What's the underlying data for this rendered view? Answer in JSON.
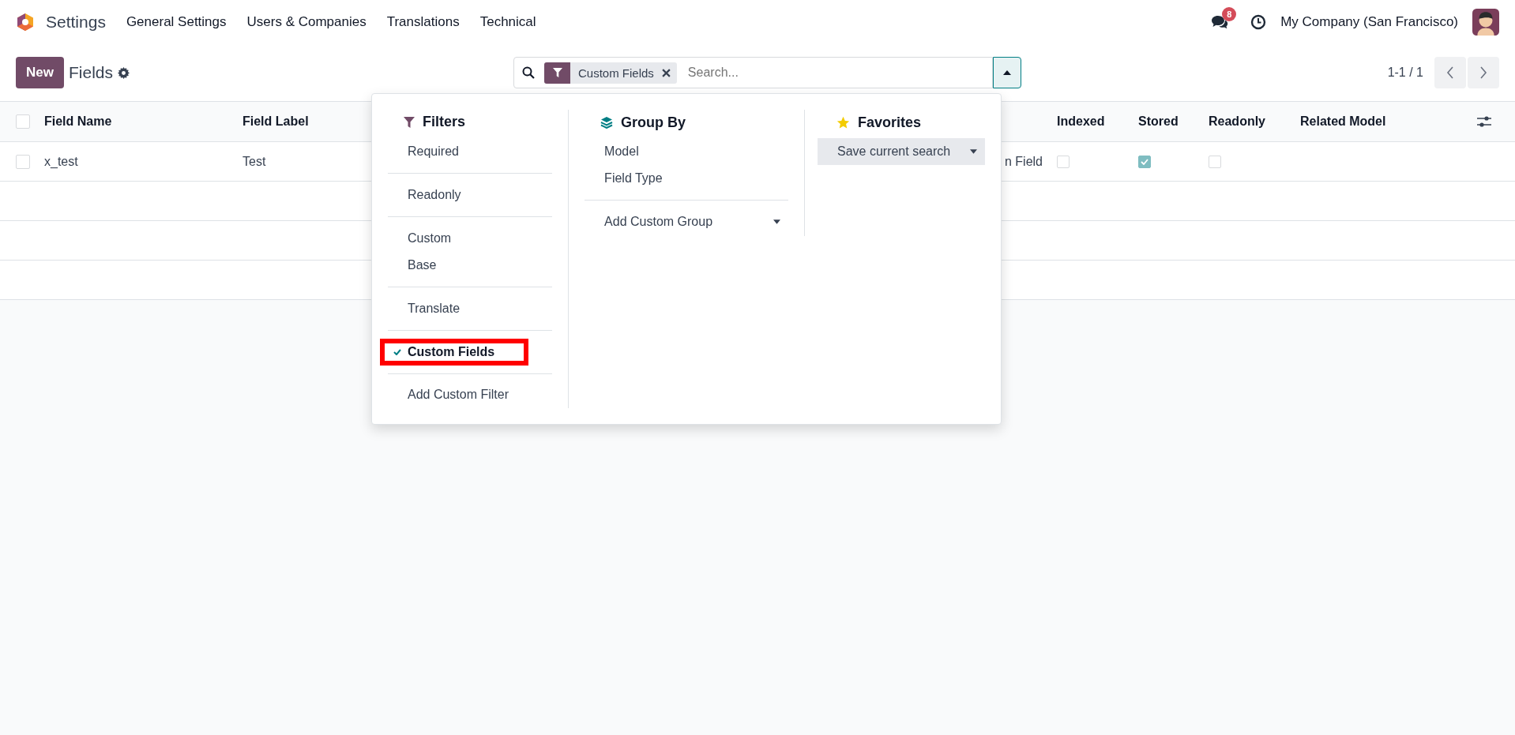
{
  "navbar": {
    "app": "Settings",
    "menu": [
      "General Settings",
      "Users & Companies",
      "Translations",
      "Technical"
    ],
    "messages_badge": "8",
    "company": "My Company (San Francisco)"
  },
  "control_panel": {
    "new_button": "New",
    "title": "Fields",
    "search": {
      "facet": "Custom Fields",
      "placeholder": "Search...",
      "expanded": true
    },
    "pager": "1-1 / 1"
  },
  "table": {
    "select_all": {
      "checked": false
    },
    "columns": [
      "Field Name",
      "Field Label",
      "Indexed",
      "Stored",
      "Readonly",
      "Related Model"
    ],
    "rows": [
      {
        "checked": false,
        "field_name": "x_test",
        "field_label": "Test",
        "column_3": "n Field",
        "indexed": false,
        "stored": true,
        "readonly": false
      }
    ]
  },
  "dropdown": {
    "filters": {
      "title": "Filters",
      "groups": [
        [
          {
            "label": "Required",
            "checked": false,
            "annotated": false
          }
        ],
        [
          {
            "label": "Readonly",
            "checked": false,
            "annotated": false
          }
        ],
        [
          {
            "label": "Custom",
            "checked": false,
            "annotated": false
          },
          {
            "label": "Base",
            "checked": false,
            "annotated": false
          }
        ],
        [
          {
            "label": "Translate",
            "checked": false,
            "annotated": false
          }
        ],
        [
          {
            "label": "Custom Fields",
            "checked": true,
            "annotated": true
          }
        ]
      ],
      "add_custom": "Add Custom Filter"
    },
    "group_by": {
      "title": "Group By",
      "items": [
        "Model",
        "Field Type"
      ],
      "add_custom": "Add Custom Group"
    },
    "favorites": {
      "title": "Favorites",
      "save": "Save current search"
    }
  }
}
